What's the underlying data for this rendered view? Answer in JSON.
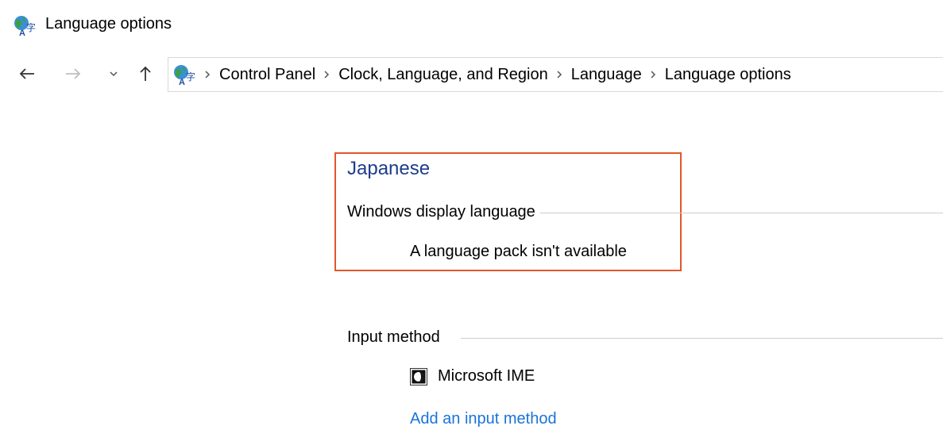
{
  "window": {
    "title": "Language options",
    "title_icon": "language-globe-icon"
  },
  "nav": {
    "back_icon": "arrow-left-icon",
    "forward_icon": "arrow-right-icon",
    "recent_icon": "chevron-down-icon",
    "up_icon": "arrow-up-icon"
  },
  "breadcrumb": {
    "icon": "language-globe-icon",
    "items": [
      "Control Panel",
      "Clock, Language, and Region",
      "Language",
      "Language options"
    ]
  },
  "language": {
    "name": "Japanese",
    "display_section_label": "Windows display language",
    "display_status": "A language pack isn't available",
    "highlight_color": "#e2572b"
  },
  "input_method": {
    "section_label": "Input method",
    "methods": [
      {
        "name": "Microsoft IME",
        "icon": "ime-icon"
      }
    ],
    "add_link": "Add an input method"
  },
  "colors": {
    "language_name": "#1e3c8c",
    "link": "#1a73d9"
  }
}
